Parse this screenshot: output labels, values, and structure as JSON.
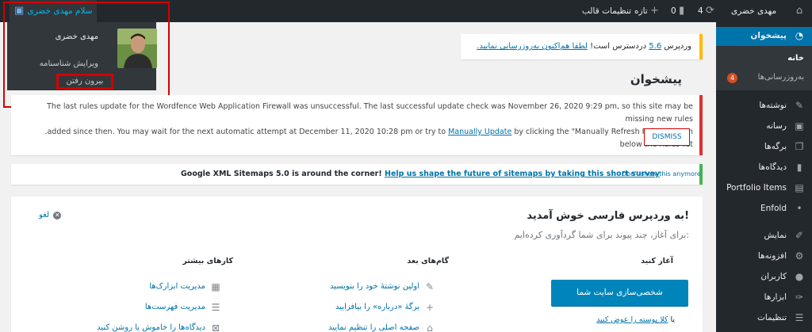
{
  "admin_bar": {
    "site_name": "مهدی خضری",
    "updates_count": "4",
    "comments_count": "0",
    "new_label": "تازه",
    "theme_settings": "تنظیمات قالب",
    "greeting": "سلام مهدی خضری"
  },
  "user_menu": {
    "display_name": "مهدی خضری",
    "edit_profile": "ویرایش شناسنامه",
    "logout": "بیرون رفتن"
  },
  "sidebar": {
    "dashboard": "پیشخوان",
    "home": "خانه",
    "updates": "به‌روزرسانی‌ها",
    "updates_badge": "4",
    "posts": "نوشته‌ها",
    "media": "رسانه",
    "pages": "برگه‌ها",
    "comments": "دیدگاه‌ها",
    "portfolio": "Portfolio Items",
    "enfold": "Enfold",
    "appearance": "نمایش",
    "plugins": "افزونه‌ها",
    "users": "کاربران",
    "tools": "ابزارها",
    "settings": "تنظیمات"
  },
  "update_nag": {
    "prefix": "وردپرس ",
    "version_link": "5.6",
    "middle": " دردسترس است! ",
    "action_link": "لطفا هم‌اکنون به‌روزرسانی نمایید."
  },
  "page_title": "پیشخوان",
  "wordfence_notice": {
    "line1": "The last rules update for the Wordfence Web Application Firewall was unsuccessful. The last successful update check was November 26, 2020 9:29 pm, so this site may be missing new rules",
    "line2_part1": ".added since then. You may wait for the next automatic attempt at December 11, 2020 10:28 pm or try to ",
    "manual_update_link": "Manually Update",
    "line2_part2": " by clicking the \"Manually Refresh Rules\" button below the Rules list",
    "dismiss": "DISMISS"
  },
  "sitemap_notice": {
    "bold_text": "Google XML Sitemaps 5.0 is around the corner! ",
    "link_text": "Help us shape the future of sitemaps by taking this short survey",
    "dismiss_link": "Don't show this anymore"
  },
  "welcome": {
    "title": "به وردپرس فارسی خوش آمدید!",
    "about": "برای آغاز، چند پیوند برای شما گردآوری کرده‌ایم:",
    "dismiss": "لغو",
    "col1_head": "آغاز کنید",
    "customize_button": "شخصی‌سازی سایت شما",
    "change_theme_prefix": "یا ",
    "change_theme_link": "کلا پوسته را عوض کنید",
    "col2_head": "گام‌های بعد",
    "col2_links": [
      "اولین نوشتهٔ خود را بنویسید",
      "برگهٔ «درباره» را بیافزایید",
      "صفحه اصلی را تنظیم نمایید"
    ],
    "col3_head": "کارهای بیشتر",
    "col3_links": [
      "مدیریت ابزارک‌ها",
      "مدیریت فهرست‌ها",
      "دیدگاه‌ها را خاموش یا روشن کنید"
    ]
  }
}
